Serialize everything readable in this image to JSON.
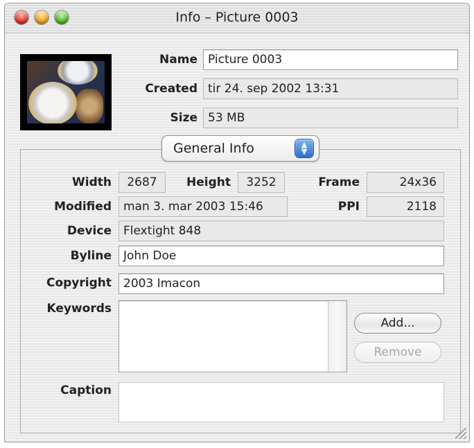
{
  "window": {
    "title": "Info – Picture 0003"
  },
  "file": {
    "name_label": "Name",
    "name": "Picture 0003",
    "created_label": "Created",
    "created": "tir 24. sep 2002 13:31",
    "size_label": "Size",
    "size": "53 MB"
  },
  "section_popup": {
    "selected": "General Info",
    "arrows": "▲▼"
  },
  "general": {
    "width_label": "Width",
    "width": "2687",
    "height_label": "Height",
    "height": "3252",
    "frame_label": "Frame",
    "frame": "24x36",
    "modified_label": "Modified",
    "modified": "man 3. mar 2003 15:46",
    "ppi_label": "PPI",
    "ppi": "2118",
    "device_label": "Device",
    "device": "Flextight 848",
    "byline_label": "Byline",
    "byline": "John Doe",
    "copyright_label": "Copyright",
    "copyright": "2003 Imacon",
    "keywords_label": "Keywords",
    "add_label": "Add...",
    "remove_label": "Remove",
    "caption_label": "Caption",
    "caption": ""
  }
}
